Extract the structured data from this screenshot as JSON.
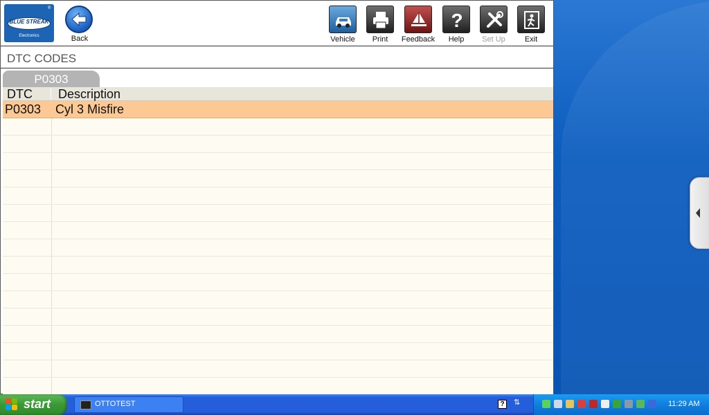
{
  "app": {
    "logo": {
      "name": "BLUE STREAK",
      "sub": "Electronics",
      "reg": "®"
    },
    "back_label": "Back",
    "toolbar": [
      {
        "id": "vehicle",
        "label": "Vehicle",
        "icon": "car-icon",
        "enabled": true
      },
      {
        "id": "print",
        "label": "Print",
        "icon": "printer-icon",
        "enabled": true
      },
      {
        "id": "feedback",
        "label": "Feedback",
        "icon": "feedback-icon",
        "enabled": true
      },
      {
        "id": "help",
        "label": "Help",
        "icon": "question-icon",
        "enabled": true
      },
      {
        "id": "setup",
        "label": "Set Up",
        "icon": "tools-icon",
        "enabled": false
      },
      {
        "id": "exit",
        "label": "Exit",
        "icon": "exit-icon",
        "enabled": true
      }
    ],
    "title": "DTC CODES",
    "tab_label": "P0303",
    "table": {
      "headers": [
        "DTC",
        "Description"
      ],
      "rows": [
        {
          "code": "P0303",
          "description": "Cyl 3 Misfire",
          "selected": true
        }
      ]
    },
    "colors": {
      "selected_row": "#fcc894",
      "accent": "#1e64b4"
    }
  },
  "taskbar": {
    "start_label": "start",
    "task": "OTTOTEST",
    "clock": "11:29 AM"
  }
}
